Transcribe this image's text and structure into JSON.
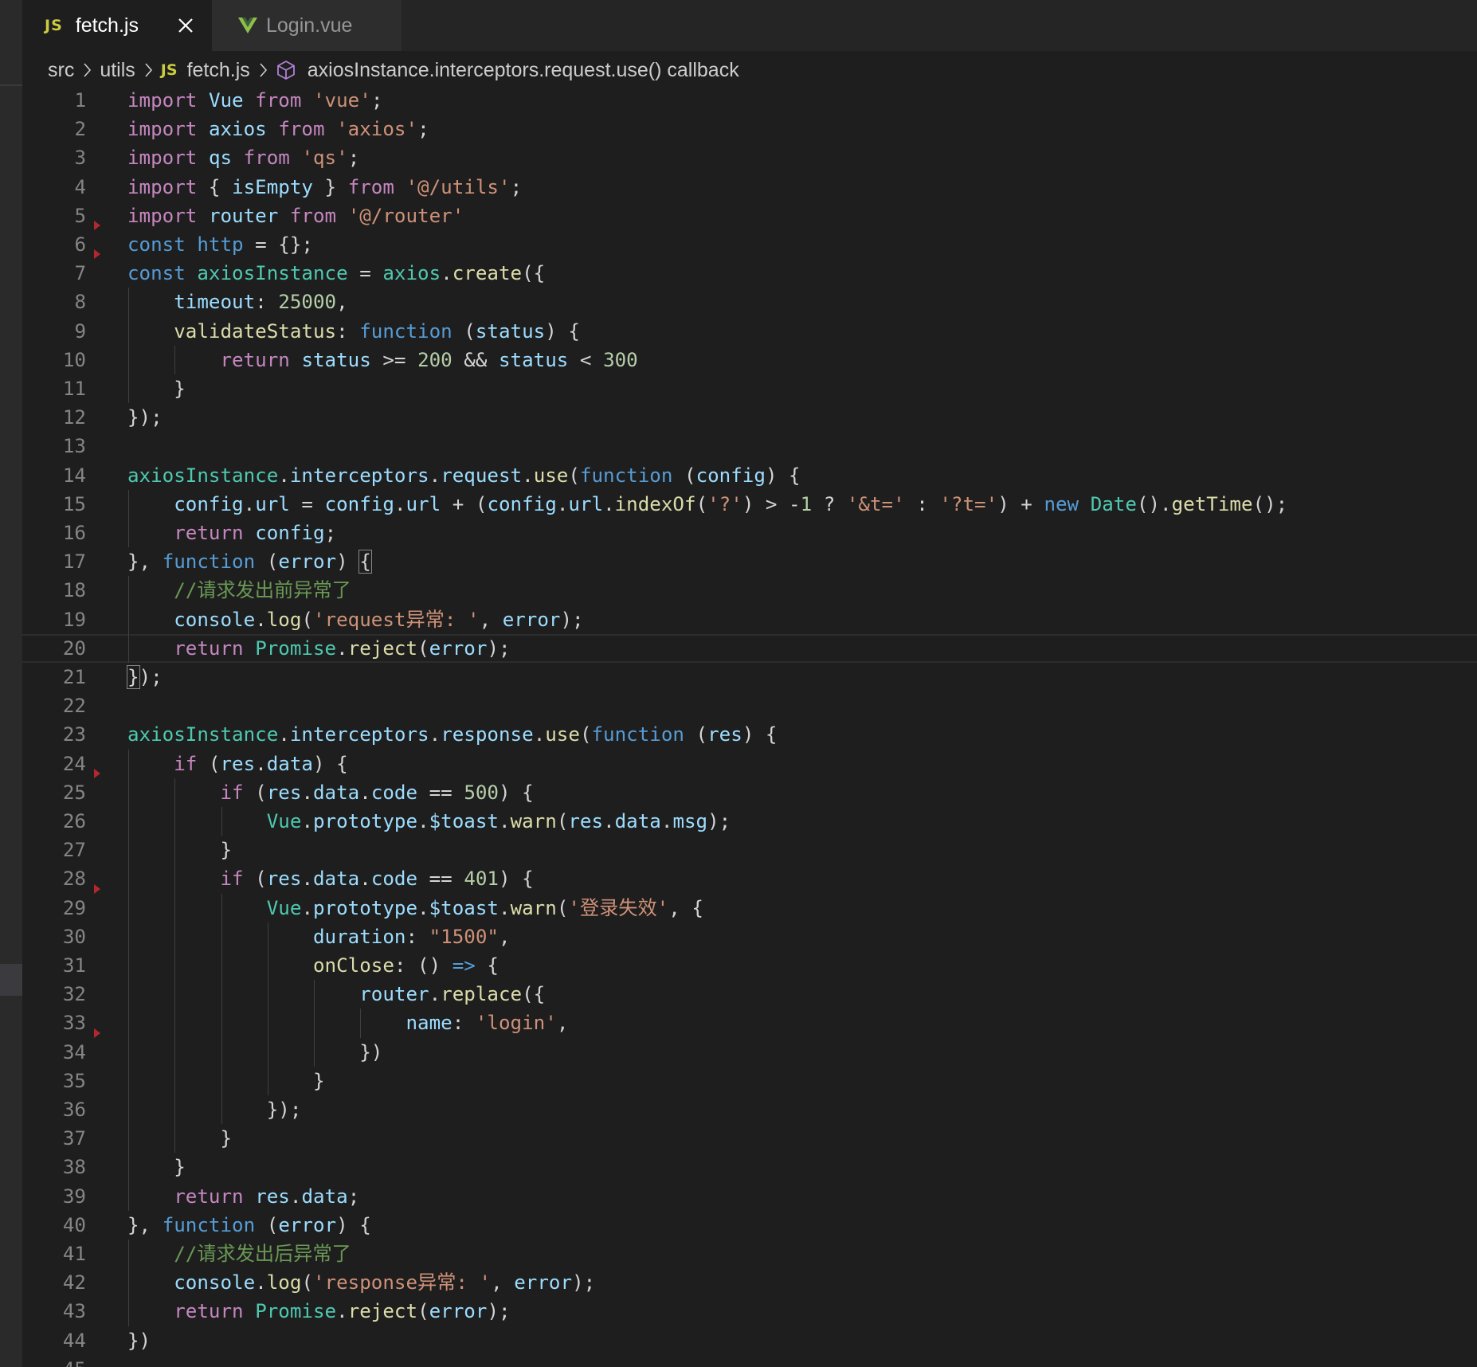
{
  "tabs": [
    {
      "icon": "js-icon",
      "icon_text": "JS",
      "label": "fetch.js",
      "active": true
    },
    {
      "icon": "vue-icon",
      "label": "Login.vue",
      "active": false
    }
  ],
  "breadcrumb": [
    {
      "label": "src"
    },
    {
      "label": "utils"
    },
    {
      "label": "fetch.js",
      "icon_text": "JS"
    },
    {
      "label": "axiosInstance.interceptors.request.use() callback",
      "icon": "symbol-method-icon"
    }
  ],
  "code_lines": [
    {
      "n": "1",
      "tokens": [
        [
          "kw",
          "import"
        ],
        [
          "pun",
          " "
        ],
        [
          "var",
          "Vue"
        ],
        [
          "pun",
          " "
        ],
        [
          "kw",
          "from"
        ],
        [
          "pun",
          " "
        ],
        [
          "str",
          "'vue'"
        ],
        [
          "pun",
          ";"
        ]
      ]
    },
    {
      "n": "2",
      "tokens": [
        [
          "kw",
          "import"
        ],
        [
          "pun",
          " "
        ],
        [
          "var",
          "axios"
        ],
        [
          "pun",
          " "
        ],
        [
          "kw",
          "from"
        ],
        [
          "pun",
          " "
        ],
        [
          "str",
          "'axios'"
        ],
        [
          "pun",
          ";"
        ]
      ]
    },
    {
      "n": "3",
      "tokens": [
        [
          "kw",
          "import"
        ],
        [
          "pun",
          " "
        ],
        [
          "var",
          "qs"
        ],
        [
          "pun",
          " "
        ],
        [
          "kw",
          "from"
        ],
        [
          "pun",
          " "
        ],
        [
          "str",
          "'qs'"
        ],
        [
          "pun",
          ";"
        ]
      ]
    },
    {
      "n": "4",
      "tokens": [
        [
          "kw",
          "import"
        ],
        [
          "pun",
          " { "
        ],
        [
          "var",
          "isEmpty"
        ],
        [
          "pun",
          " } "
        ],
        [
          "kw",
          "from"
        ],
        [
          "pun",
          " "
        ],
        [
          "str",
          "'@/utils'"
        ],
        [
          "pun",
          ";"
        ]
      ]
    },
    {
      "n": "5",
      "tokens": [
        [
          "kw",
          "import"
        ],
        [
          "pun",
          " "
        ],
        [
          "var",
          "router"
        ],
        [
          "pun",
          " "
        ],
        [
          "kw",
          "from"
        ],
        [
          "pun",
          " "
        ],
        [
          "str",
          "'@/router'"
        ]
      ]
    },
    {
      "n": "6",
      "tokens": [
        [
          "st",
          "const"
        ],
        [
          "pun",
          " "
        ],
        [
          "st",
          "http"
        ],
        [
          "pun",
          " = {};"
        ]
      ]
    },
    {
      "n": "7",
      "tokens": [
        [
          "st",
          "const"
        ],
        [
          "pun",
          " "
        ],
        [
          "cls",
          "axiosInstance"
        ],
        [
          "pun",
          " = "
        ],
        [
          "cls",
          "axios"
        ],
        [
          "pun",
          "."
        ],
        [
          "fn",
          "create"
        ],
        [
          "pun",
          "({"
        ]
      ]
    },
    {
      "n": "8",
      "tokens": [
        [
          "pun",
          "    "
        ],
        [
          "var",
          "timeout"
        ],
        [
          "pun",
          ": "
        ],
        [
          "num",
          "25000"
        ],
        [
          "pun",
          ","
        ]
      ]
    },
    {
      "n": "9",
      "tokens": [
        [
          "pun",
          "    "
        ],
        [
          "fn",
          "validateStatus"
        ],
        [
          "pun",
          ": "
        ],
        [
          "st",
          "function"
        ],
        [
          "pun",
          " ("
        ],
        [
          "var",
          "status"
        ],
        [
          "pun",
          ") {"
        ]
      ]
    },
    {
      "n": "10",
      "tokens": [
        [
          "pun",
          "        "
        ],
        [
          "kw",
          "return"
        ],
        [
          "pun",
          " "
        ],
        [
          "var",
          "status"
        ],
        [
          "pun",
          " >= "
        ],
        [
          "num",
          "200"
        ],
        [
          "pun",
          " && "
        ],
        [
          "var",
          "status"
        ],
        [
          "pun",
          " < "
        ],
        [
          "num",
          "300"
        ]
      ]
    },
    {
      "n": "11",
      "tokens": [
        [
          "pun",
          "    }"
        ]
      ]
    },
    {
      "n": "12",
      "tokens": [
        [
          "pun",
          "});"
        ]
      ]
    },
    {
      "n": "13",
      "tokens": []
    },
    {
      "n": "14",
      "tokens": [
        [
          "cls",
          "axiosInstance"
        ],
        [
          "pun",
          "."
        ],
        [
          "var",
          "interceptors"
        ],
        [
          "pun",
          "."
        ],
        [
          "var",
          "request"
        ],
        [
          "pun",
          "."
        ],
        [
          "fn",
          "use"
        ],
        [
          "pun",
          "("
        ],
        [
          "st",
          "function"
        ],
        [
          "pun",
          " ("
        ],
        [
          "var",
          "config"
        ],
        [
          "pun",
          ") {"
        ]
      ]
    },
    {
      "n": "15",
      "tokens": [
        [
          "pun",
          "    "
        ],
        [
          "var",
          "config"
        ],
        [
          "pun",
          "."
        ],
        [
          "var",
          "url"
        ],
        [
          "pun",
          " = "
        ],
        [
          "var",
          "config"
        ],
        [
          "pun",
          "."
        ],
        [
          "var",
          "url"
        ],
        [
          "pun",
          " + ("
        ],
        [
          "var",
          "config"
        ],
        [
          "pun",
          "."
        ],
        [
          "var",
          "url"
        ],
        [
          "pun",
          "."
        ],
        [
          "fn",
          "indexOf"
        ],
        [
          "pun",
          "("
        ],
        [
          "str",
          "'?'"
        ],
        [
          "pun",
          ") > -"
        ],
        [
          "num",
          "1"
        ],
        [
          "pun",
          " ? "
        ],
        [
          "str",
          "'&t='"
        ],
        [
          "pun",
          " : "
        ],
        [
          "str",
          "'?t='"
        ],
        [
          "pun",
          ") + "
        ],
        [
          "st",
          "new"
        ],
        [
          "pun",
          " "
        ],
        [
          "cls",
          "Date"
        ],
        [
          "pun",
          "()."
        ],
        [
          "fn",
          "getTime"
        ],
        [
          "pun",
          "();"
        ]
      ]
    },
    {
      "n": "16",
      "tokens": [
        [
          "pun",
          "    "
        ],
        [
          "kw",
          "return"
        ],
        [
          "pun",
          " "
        ],
        [
          "var",
          "config"
        ],
        [
          "pun",
          ";"
        ]
      ]
    },
    {
      "n": "17",
      "tokens": [
        [
          "pun",
          "}, "
        ],
        [
          "st",
          "function"
        ],
        [
          "pun",
          " ("
        ],
        [
          "var",
          "error"
        ],
        [
          "pun",
          ") "
        ],
        [
          "box",
          "{"
        ]
      ]
    },
    {
      "n": "18",
      "tokens": [
        [
          "pun",
          "    "
        ],
        [
          "com",
          "//请求发出前异常了"
        ]
      ]
    },
    {
      "n": "19",
      "tokens": [
        [
          "pun",
          "    "
        ],
        [
          "var",
          "console"
        ],
        [
          "pun",
          "."
        ],
        [
          "fn",
          "log"
        ],
        [
          "pun",
          "("
        ],
        [
          "str",
          "'request异常: '"
        ],
        [
          "pun",
          ", "
        ],
        [
          "var",
          "error"
        ],
        [
          "pun",
          ");"
        ]
      ]
    },
    {
      "n": "20",
      "tokens": [
        [
          "pun",
          "    "
        ],
        [
          "kw",
          "return"
        ],
        [
          "pun",
          " "
        ],
        [
          "cls",
          "Promise"
        ],
        [
          "pun",
          "."
        ],
        [
          "fn",
          "reject"
        ],
        [
          "pun",
          "("
        ],
        [
          "var",
          "error"
        ],
        [
          "pun",
          ");"
        ]
      ]
    },
    {
      "n": "21",
      "tokens": [
        [
          "box",
          "}"
        ],
        [
          "pun",
          ");"
        ]
      ]
    },
    {
      "n": "22",
      "tokens": []
    },
    {
      "n": "23",
      "tokens": [
        [
          "cls",
          "axiosInstance"
        ],
        [
          "pun",
          "."
        ],
        [
          "var",
          "interceptors"
        ],
        [
          "pun",
          "."
        ],
        [
          "var",
          "response"
        ],
        [
          "pun",
          "."
        ],
        [
          "fn",
          "use"
        ],
        [
          "pun",
          "("
        ],
        [
          "st",
          "function"
        ],
        [
          "pun",
          " ("
        ],
        [
          "var",
          "res"
        ],
        [
          "pun",
          ") {"
        ]
      ]
    },
    {
      "n": "24",
      "tokens": [
        [
          "pun",
          "    "
        ],
        [
          "kw",
          "if"
        ],
        [
          "pun",
          " ("
        ],
        [
          "var",
          "res"
        ],
        [
          "pun",
          "."
        ],
        [
          "var",
          "data"
        ],
        [
          "pun",
          ") {"
        ]
      ]
    },
    {
      "n": "25",
      "tokens": [
        [
          "pun",
          "        "
        ],
        [
          "kw",
          "if"
        ],
        [
          "pun",
          " ("
        ],
        [
          "var",
          "res"
        ],
        [
          "pun",
          "."
        ],
        [
          "var",
          "data"
        ],
        [
          "pun",
          "."
        ],
        [
          "var",
          "code"
        ],
        [
          "pun",
          " == "
        ],
        [
          "num",
          "500"
        ],
        [
          "pun",
          ") {"
        ]
      ]
    },
    {
      "n": "26",
      "tokens": [
        [
          "pun",
          "            "
        ],
        [
          "cls",
          "Vue"
        ],
        [
          "pun",
          "."
        ],
        [
          "var",
          "prototype"
        ],
        [
          "pun",
          "."
        ],
        [
          "var",
          "$toast"
        ],
        [
          "pun",
          "."
        ],
        [
          "fn",
          "warn"
        ],
        [
          "pun",
          "("
        ],
        [
          "var",
          "res"
        ],
        [
          "pun",
          "."
        ],
        [
          "var",
          "data"
        ],
        [
          "pun",
          "."
        ],
        [
          "var",
          "msg"
        ],
        [
          "pun",
          ");"
        ]
      ]
    },
    {
      "n": "27",
      "tokens": [
        [
          "pun",
          "        }"
        ]
      ]
    },
    {
      "n": "28",
      "tokens": [
        [
          "pun",
          "        "
        ],
        [
          "kw",
          "if"
        ],
        [
          "pun",
          " ("
        ],
        [
          "var",
          "res"
        ],
        [
          "pun",
          "."
        ],
        [
          "var",
          "data"
        ],
        [
          "pun",
          "."
        ],
        [
          "var",
          "code"
        ],
        [
          "pun",
          " == "
        ],
        [
          "num",
          "401"
        ],
        [
          "pun",
          ") {"
        ]
      ]
    },
    {
      "n": "29",
      "tokens": [
        [
          "pun",
          "            "
        ],
        [
          "cls",
          "Vue"
        ],
        [
          "pun",
          "."
        ],
        [
          "var",
          "prototype"
        ],
        [
          "pun",
          "."
        ],
        [
          "var",
          "$toast"
        ],
        [
          "pun",
          "."
        ],
        [
          "fn",
          "warn"
        ],
        [
          "pun",
          "("
        ],
        [
          "str",
          "'登录失效'"
        ],
        [
          "pun",
          ", {"
        ]
      ]
    },
    {
      "n": "30",
      "tokens": [
        [
          "pun",
          "                "
        ],
        [
          "var",
          "duration"
        ],
        [
          "pun",
          ": "
        ],
        [
          "str",
          "\"1500\""
        ],
        [
          "pun",
          ","
        ]
      ]
    },
    {
      "n": "31",
      "tokens": [
        [
          "pun",
          "                "
        ],
        [
          "fn",
          "onClose"
        ],
        [
          "pun",
          ": () "
        ],
        [
          "st",
          "=>"
        ],
        [
          "pun",
          " {"
        ]
      ]
    },
    {
      "n": "32",
      "tokens": [
        [
          "pun",
          "                    "
        ],
        [
          "var",
          "router"
        ],
        [
          "pun",
          "."
        ],
        [
          "fn",
          "replace"
        ],
        [
          "pun",
          "({"
        ]
      ]
    },
    {
      "n": "33",
      "tokens": [
        [
          "pun",
          "                        "
        ],
        [
          "var",
          "name"
        ],
        [
          "pun",
          ": "
        ],
        [
          "str",
          "'login'"
        ],
        [
          "pun",
          ","
        ]
      ]
    },
    {
      "n": "34",
      "tokens": [
        [
          "pun",
          "                    })"
        ]
      ]
    },
    {
      "n": "35",
      "tokens": [
        [
          "pun",
          "                }"
        ]
      ]
    },
    {
      "n": "36",
      "tokens": [
        [
          "pun",
          "            });"
        ]
      ]
    },
    {
      "n": "37",
      "tokens": [
        [
          "pun",
          "        }"
        ]
      ]
    },
    {
      "n": "38",
      "tokens": [
        [
          "pun",
          "    }"
        ]
      ]
    },
    {
      "n": "39",
      "tokens": [
        [
          "pun",
          "    "
        ],
        [
          "kw",
          "return"
        ],
        [
          "pun",
          " "
        ],
        [
          "var",
          "res"
        ],
        [
          "pun",
          "."
        ],
        [
          "var",
          "data"
        ],
        [
          "pun",
          ";"
        ]
      ]
    },
    {
      "n": "40",
      "tokens": [
        [
          "pun",
          "}, "
        ],
        [
          "st",
          "function"
        ],
        [
          "pun",
          " ("
        ],
        [
          "var",
          "error"
        ],
        [
          "pun",
          ") {"
        ]
      ]
    },
    {
      "n": "41",
      "tokens": [
        [
          "pun",
          "    "
        ],
        [
          "com",
          "//请求发出后异常了"
        ]
      ]
    },
    {
      "n": "42",
      "tokens": [
        [
          "pun",
          "    "
        ],
        [
          "var",
          "console"
        ],
        [
          "pun",
          "."
        ],
        [
          "fn",
          "log"
        ],
        [
          "pun",
          "("
        ],
        [
          "str",
          "'response异常: '"
        ],
        [
          "pun",
          ", "
        ],
        [
          "var",
          "error"
        ],
        [
          "pun",
          ");"
        ]
      ]
    },
    {
      "n": "43",
      "tokens": [
        [
          "pun",
          "    "
        ],
        [
          "kw",
          "return"
        ],
        [
          "pun",
          " "
        ],
        [
          "cls",
          "Promise"
        ],
        [
          "pun",
          "."
        ],
        [
          "fn",
          "reject"
        ],
        [
          "pun",
          "("
        ],
        [
          "var",
          "error"
        ],
        [
          "pun",
          ");"
        ]
      ]
    },
    {
      "n": "44",
      "tokens": [
        [
          "pun",
          "})"
        ]
      ]
    },
    {
      "n": "45",
      "tokens": []
    }
  ],
  "current_line": "20",
  "fold_markers": [
    "6",
    "7",
    "25",
    "29",
    "34"
  ],
  "colors": {
    "keyword": "#c586c0",
    "storage": "#569cd6",
    "variable": "#9cdcfe",
    "function": "#dcdcaa",
    "string": "#ce9178",
    "number": "#b5cea8",
    "class": "#4ec9b0",
    "comment": "#6a9955",
    "editor_bg": "#1e1e1e"
  }
}
